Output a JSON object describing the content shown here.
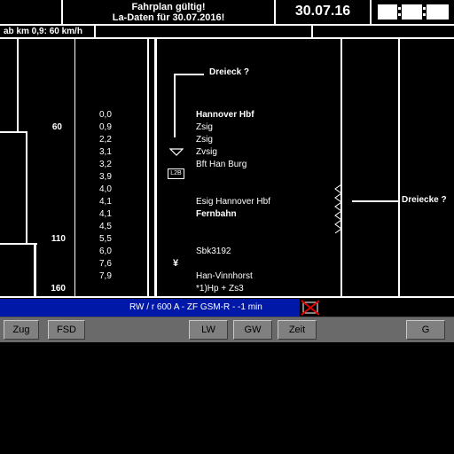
{
  "header": {
    "status_line1": "Fahrplan gültig!",
    "status_line2": "La-Daten für 30.07.2016!",
    "date": "30.07.16"
  },
  "speed_notice": "ab km 0,9: 60 km/h",
  "speed_profile": {
    "labels": [
      "60",
      "110",
      "160"
    ]
  },
  "km": [
    "0,0",
    "0,9",
    "2,2",
    "3,1",
    "3,2",
    "3,9",
    "4,0",
    "4,1",
    "4,1",
    "4,5",
    "5,5",
    "6,0",
    "7,6",
    "7,9"
  ],
  "route": {
    "dreieck_top": "Dreieck ?",
    "stations": [
      {
        "name": "Hannover Hbf",
        "bold": true
      },
      {
        "name": "Zsig",
        "bold": false
      },
      {
        "name": "Zsig",
        "bold": false
      },
      {
        "name": "Zvsig",
        "bold": false
      },
      {
        "name": "Bft Han Burg",
        "bold": false
      },
      {
        "name": "Esig Hannover Hbf",
        "bold": false
      },
      {
        "name": "Fernbahn",
        "bold": true
      },
      {
        "name": "Sbk3192",
        "bold": false
      },
      {
        "name": "Han-Vinnhorst",
        "bold": false
      },
      {
        "name": "*1)Hp + Zs3",
        "bold": false
      }
    ],
    "lzb_sign": "L2B",
    "yen_symbol": "¥",
    "dreiecke_right": "Dreiecke ?"
  },
  "info_bar": {
    "text": "RW / r    600 A    - ZF GSM-R -     -1 min"
  },
  "toolbar": {
    "zug": "Zug",
    "fsd": "FSD",
    "lw": "LW",
    "gw": "GW",
    "zeit": "Zeit",
    "g": "G"
  },
  "colors": {
    "info_bar": "#0018a8",
    "button_face": "#808080",
    "gsmr_cross": "#e00000"
  }
}
